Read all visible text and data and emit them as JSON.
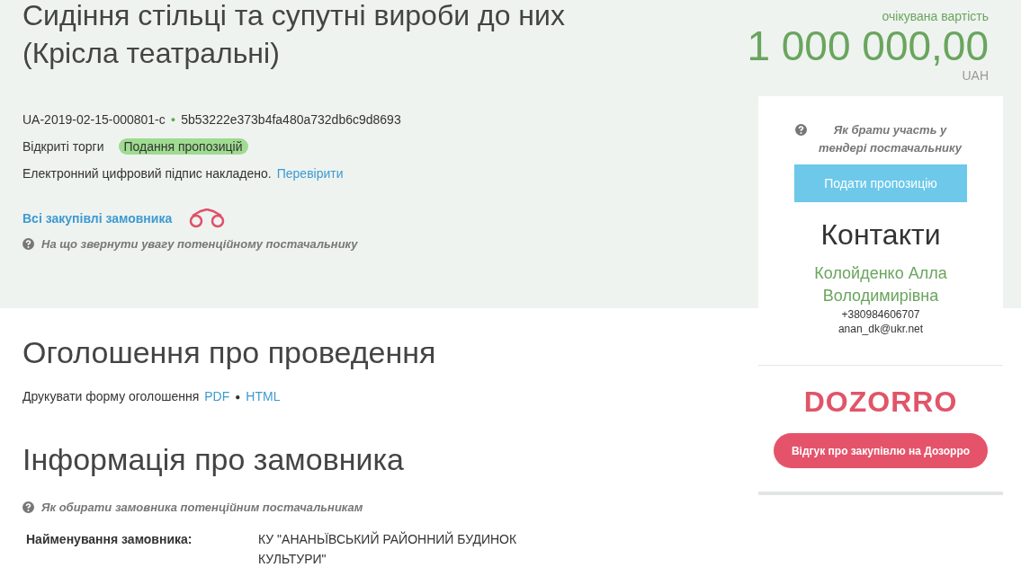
{
  "tender": {
    "title": "Сидіння стільці та супутні вироби до них (Крісла театральні)",
    "id": "UA-2019-02-15-000801-c",
    "separator": "●",
    "hash": "5b53222e373b4fa480a732db6c9d8693",
    "procedure": "Відкриті торги",
    "status": "Подання пропозицій",
    "signature_text": "Електронний цифровий підпис накладено.",
    "verify_link": "Перевірити",
    "all_purchases_link": "Всі закупівлі замовника",
    "hint": "На що звернути увагу потенційному постачальнику"
  },
  "value": {
    "label": "очікувана вартість",
    "amount": "1 000 000,00",
    "currency": "UAH"
  },
  "sidebar": {
    "hint": "Як брати участь у тендері постачальнику",
    "submit_button": "Подати пропозицію",
    "contacts_title": "Контакти",
    "contact_name": "Колойденко Алла Володимирівна",
    "phone": "+380984606707",
    "email": "anan_dk@ukr.net",
    "logo": "DOZORRO",
    "feedback_button": "Відгук про закупівлю на Дозорро"
  },
  "announcement": {
    "title": "Оголошення про проведення",
    "print_label": "Друкувати форму оголошення",
    "pdf_link": "PDF",
    "separator": "●",
    "html_link": "HTML"
  },
  "customer": {
    "title": "Інформація про замовника",
    "hint": "Як обирати замовника потенційним постачальникам",
    "fields": [
      {
        "label": "Найменування замовника:",
        "value": "КУ \"АНАНЬЇВСЬКИЙ РАЙОННИЙ БУДИНОК КУЛЬТУРИ\""
      }
    ]
  }
}
